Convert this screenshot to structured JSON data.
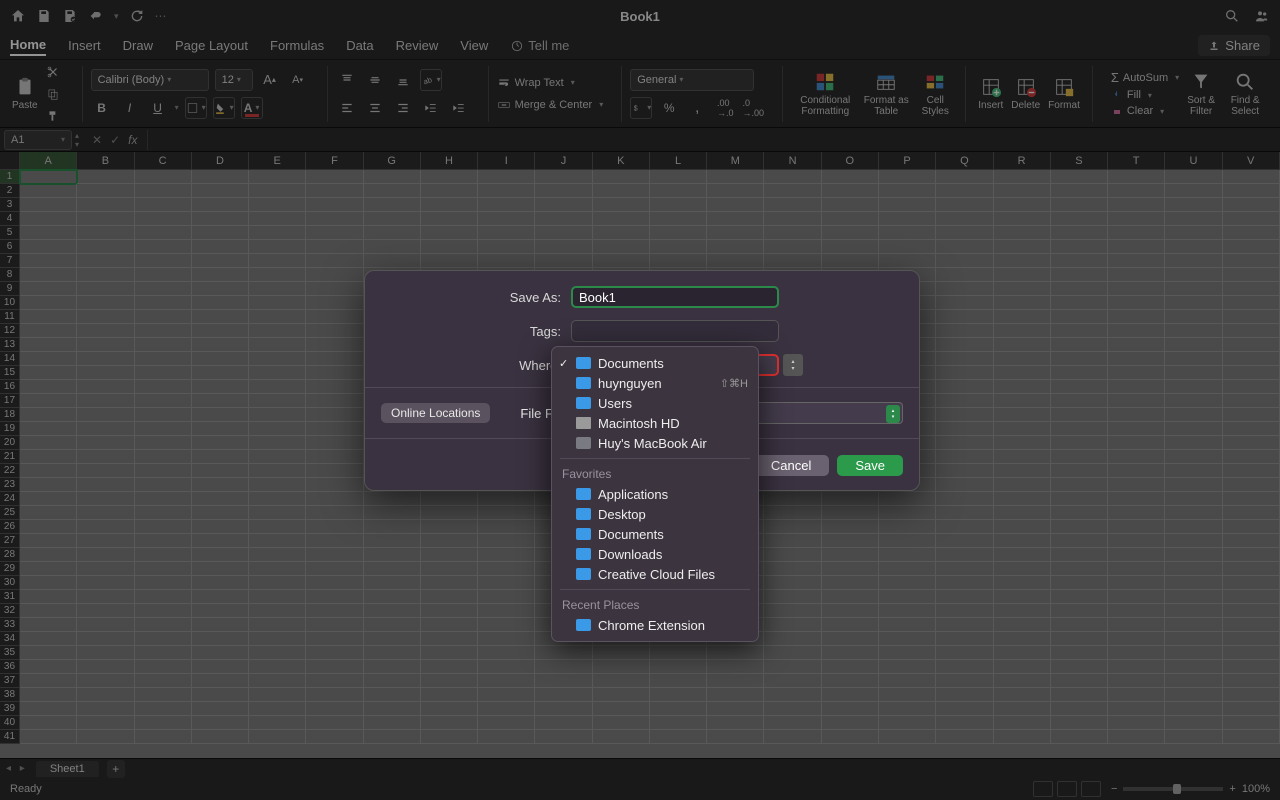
{
  "titlebar": {
    "title": "Book1"
  },
  "tabs": {
    "items": [
      "Home",
      "Insert",
      "Draw",
      "Page Layout",
      "Formulas",
      "Data",
      "Review",
      "View"
    ],
    "active": "Home",
    "tell_me": "Tell me",
    "share": "Share"
  },
  "ribbon": {
    "paste": "Paste",
    "font_name": "Calibri (Body)",
    "font_size": "12",
    "wrap_text": "Wrap Text",
    "merge_center": "Merge & Center",
    "number_format": "General",
    "cond_format": "Conditional Formatting",
    "format_table": "Format as Table",
    "cell_styles": "Cell Styles",
    "insert": "Insert",
    "delete": "Delete",
    "format": "Format",
    "autosum": "AutoSum",
    "fill": "Fill",
    "clear": "Clear",
    "sort_filter": "Sort & Filter",
    "find_select": "Find & Select"
  },
  "formula_bar": {
    "name_box": "A1"
  },
  "columns": [
    "A",
    "B",
    "C",
    "D",
    "E",
    "F",
    "G",
    "H",
    "I",
    "J",
    "K",
    "L",
    "M",
    "N",
    "O",
    "P",
    "Q",
    "R",
    "S",
    "T",
    "U",
    "V"
  ],
  "sheet": {
    "name": "Sheet1"
  },
  "status": {
    "ready": "Ready",
    "zoom": "100%"
  },
  "dialog": {
    "save_as_label": "Save As:",
    "save_as_value": "Book1",
    "tags_label": "Tags:",
    "where_label": "Where:",
    "where_value": "Documents",
    "online_locations": "Online Locations",
    "file_format_label": "File Format:",
    "cancel": "Cancel",
    "save": "Save"
  },
  "dropdown": {
    "locations": [
      {
        "label": "Documents",
        "icon": "folder",
        "checked": true
      },
      {
        "label": "huynguyen",
        "icon": "home",
        "shortcut": "⇧⌘H"
      },
      {
        "label": "Users",
        "icon": "folder"
      },
      {
        "label": "Macintosh HD",
        "icon": "disk"
      },
      {
        "label": "Huy's MacBook Air",
        "icon": "laptop"
      }
    ],
    "favorites_header": "Favorites",
    "favorites": [
      {
        "label": "Applications",
        "icon": "folder"
      },
      {
        "label": "Desktop",
        "icon": "folder"
      },
      {
        "label": "Documents",
        "icon": "folder"
      },
      {
        "label": "Downloads",
        "icon": "folder"
      },
      {
        "label": "Creative Cloud Files",
        "icon": "folder"
      }
    ],
    "recent_header": "Recent Places",
    "recent": [
      {
        "label": "Chrome Extension",
        "icon": "folder"
      }
    ]
  }
}
